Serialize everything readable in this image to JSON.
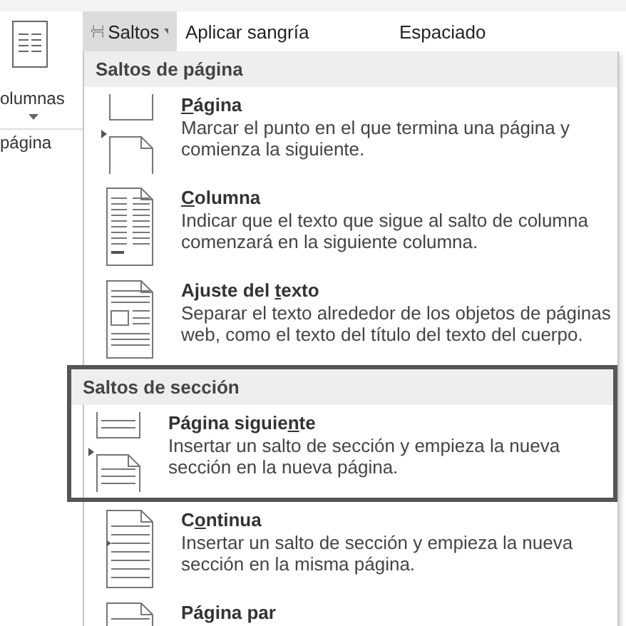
{
  "ribbon": {
    "columns_button": {
      "label": "olumnas"
    },
    "group_label": "página",
    "toolbar": [
      {
        "kind": "dropdown",
        "label": "Saltos",
        "pressed": true
      },
      {
        "kind": "text",
        "label": "Aplicar sangría",
        "pressed": false
      },
      {
        "kind": "text",
        "label": "Espaciado",
        "pressed": false
      }
    ]
  },
  "menu": {
    "sections": [
      {
        "title": "Saltos de página",
        "highlighted": false,
        "items": [
          {
            "kind": "page",
            "label": {
              "key": "P",
              "after": "ágina"
            },
            "description": "Marcar el punto en el que termina una página y comienza la siguiente."
          },
          {
            "kind": "column",
            "label": {
              "key": "C",
              "after": "olumna"
            },
            "description": "Indicar que el texto que sigue al salto de columna comenzará en la siguiente columna."
          },
          {
            "kind": "wrap",
            "label": {
              "before": "Ajuste del ",
              "key": "t",
              "after": "exto"
            },
            "description": "Separar el texto alrededor de los objetos de páginas web, como el texto del título del texto del cuerpo."
          }
        ]
      },
      {
        "title": "Saltos de sección",
        "highlighted": true,
        "items": [
          {
            "kind": "next",
            "label": {
              "before": "Página siguie",
              "key": "n",
              "after": "te"
            },
            "description": "Insertar un salto de sección y empieza la nueva sección en la nueva página."
          },
          {
            "kind": "continuous",
            "label": {
              "before": "C",
              "key": "o",
              "after": "ntinua"
            },
            "description": "Insertar un salto de sección y empieza la nueva sección en la misma página."
          },
          {
            "kind": "even",
            "label": {
              "before": "Página par"
            }
          }
        ]
      }
    ]
  }
}
